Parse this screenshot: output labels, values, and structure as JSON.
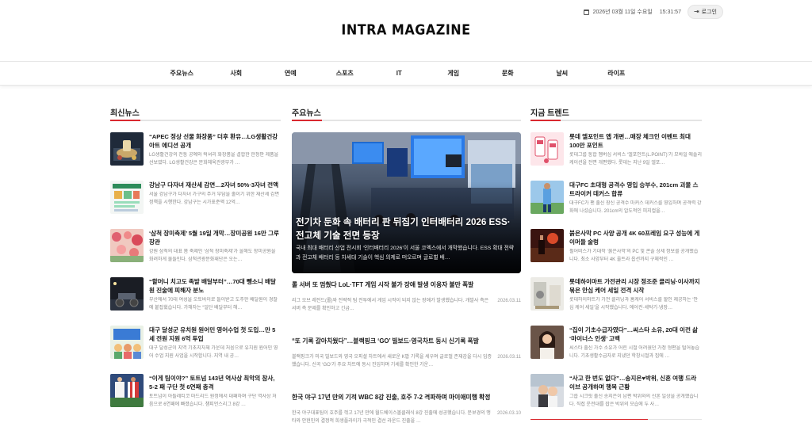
{
  "header": {
    "datetime": "2026년 03월 11일 수요일",
    "time": "15:31:57",
    "login_label": "로그인",
    "logo": "INTRA MAGAZINE"
  },
  "nav": [
    "주요뉴스",
    "사회",
    "연예",
    "스포츠",
    "IT",
    "게임",
    "문화",
    "날씨",
    "라이프"
  ],
  "latest": {
    "title": "최신뉴스",
    "items": [
      {
        "title": "“APEC 정상 선물 화장품” 더후 환유…LG생활건강 아트 에디션 공개",
        "desc": "LG생활건강의 전통 공예와 럭셔리 화장품을 결합한 한정판 제품을 선보였다. LG생활건강은 문화체육관광부가 …"
      },
      {
        "title": "강남구 다자녀 재산세 감면…2자녀 50%·3자녀 전액",
        "desc": "서울 강남구가 다자녀 가구의 주거 부담을 줄이기 위한 재산세 감면 정책을 시행한다. 강남구는 시가표준액 12억…"
      },
      {
        "title": "‘삼척 장미축제’ 5월 19일 개막…장미공원 16만 그루 장관",
        "desc": "강원 삼척의 대표 봄 축제인 ‘삼척 장미축제’가 올해도 장미공원을 화려하게 물들인다. 삼척관광문화재단은 오는…"
      },
      {
        "title": "“할머니 치고도 족발 배달부터”…70대 뺑소니 배달원 진술에 피해자 분노",
        "desc": "부산에서 70대 여성을 오토바이로 들이받고 도주한 배달원이 경찰에 붙잡혔습니다. 가해자는 “일단 배달부터 해…"
      },
      {
        "title": "대구 달성군 유치원 원어민 영어수업 첫 도입…만 5세 전원 지원 6억 투입",
        "desc": "대구 달성군이 지역 기초지자체 가운데 처음으로 유치원 원어민 영어 수업 지원 사업을 시작합니다. 지역 내 공…"
      },
      {
        "title": "“이게 팀이야?” 토트넘 143년 역사상 최악의 참사, 5-2 패 구단 첫 6연패 충격",
        "desc": "토트넘이 아틀레티코 마드리드 원정에서 대패하며 구단 역사상 처음으로 6연패에 빠졌습니다. 챔피언스리그 8강 …"
      }
    ]
  },
  "main": {
    "title": "주요뉴스",
    "hero": {
      "title": "전기차 둔화 속 배터리 판 뒤집기 인터배터리 2026 ESS·전고체 기술 전면 등장",
      "desc": "국내 최대 배터리 산업 전시회 ‘인터배터리 2026’이 서울 코엑스에서 개막했습니다. ESS 확대 전략과 전고체 배터리 등 차세대 기술이 핵심 의제로 떠오르며 글로벌 배…"
    },
    "news": [
      {
        "title": "롤 서버 또 멈췄다 LoL·TFT 게임 시작 불가 장애 발생 이용자 불만 폭발",
        "desc": "리그 오브 레전드(롤)와 전략적 팀 전투에서 게임 시작이 되지 않는 장애가 발생했습니다. 개발사 측은 서버 측 문제를 확인하고 긴급…",
        "date": "2026.03.11"
      },
      {
        "title": "“또 기록 갈아치웠다”…블랙핑크 ‘GO’ 빌보드·영국차트 동시 신기록 폭발",
        "desc": "블랙핑크가 미국 빌보드와 영국 오피셜 차트에서 새로운 K팝 기록을 세우며 글로벌 존재감을 다시 입증했습니다. 신곡 ‘GO’가 주요 차트에 동시 진입하며 기세를 확인한 가운…",
        "date": "2026.03.11"
      },
      {
        "title": "한국 야구 17년 만의 기적 WBC 8강 진출, 호주 7-2 격파하며 마이애미행 확정",
        "desc": "한국 야구대표팀이 호주를 꺾고 17년 만에 월드베이스볼클래식 8강 진출에 성공했습니다. 문보경의 맹타와 안현민의 결정적 희생플라이가 극적인 결선 라운드 진출을 …",
        "date": "2026.03.10"
      }
    ]
  },
  "trend": {
    "title": "지금 트렌드",
    "items": [
      {
        "title": "롯데 엘포인트 앱 개편…매장 체크인 이벤트 최대 100만 포인트",
        "desc": "롯데그룹 통합 멤버십 서비스 ‘엘포인트(L.POINT)’가 모바일 애플리케이션을 전면 개편했다. 롯데는 지난 9일 엘포…"
      },
      {
        "title": "대구FC 초대형 공격수 영입 승부수, 201cm 괴물 스트라이커 데커스 합류",
        "desc": "대구FC가 팬 출신 장신 공격수 마커스 데커스를 영입하며 공격력 강화에 나섰습니다. 201cm의 압도적인 피지컬을…"
      },
      {
        "title": "붉은사막 PC 사양 공개 4K 60프레임 요구 성능에 게이머들 술렁",
        "desc": "펄어비스가 기대작 ‘붉은사막’의 PC 및 콘솔 상세 정보를 공개했습니다. 최소 사양부터 4K 울트라 옵션까지 구체적인 …"
      },
      {
        "title": "롯데하이마트 가전관리 시장 정조준 클리닝·이사까지 묶은 안심 케어 세일 전격 시작",
        "desc": "롯데하이마트가 가전 클리닝과 홈케어 서비스를 할인 제공하는 ‘안심 케어 세일’을 시작했습니다. 에어컨·세탁기·냉장…"
      },
      {
        "title": "“집이 기초수급자였다”…씨스타 소유, 20대 이전 삶 ‘마이너스 인생’ 고백",
        "desc": "씨스타 출신 가수 소유가 어린 시절 어려웠던 가정 형편을 털어놓습니다. 기초생활수급자로 지냈던 학창시절과 집에 …"
      },
      {
        "title": "“사고 한 번도 없다”…송지은♥박위, 신혼 여행 드라이브 공개하며 행복 근황",
        "desc": "그룹 시크릿 출신 송지은이 남편 박위와의 신혼 일상을 공개했습니다. 직접 운전대를 잡은 박위의 모습에 두 사…"
      }
    ]
  }
}
